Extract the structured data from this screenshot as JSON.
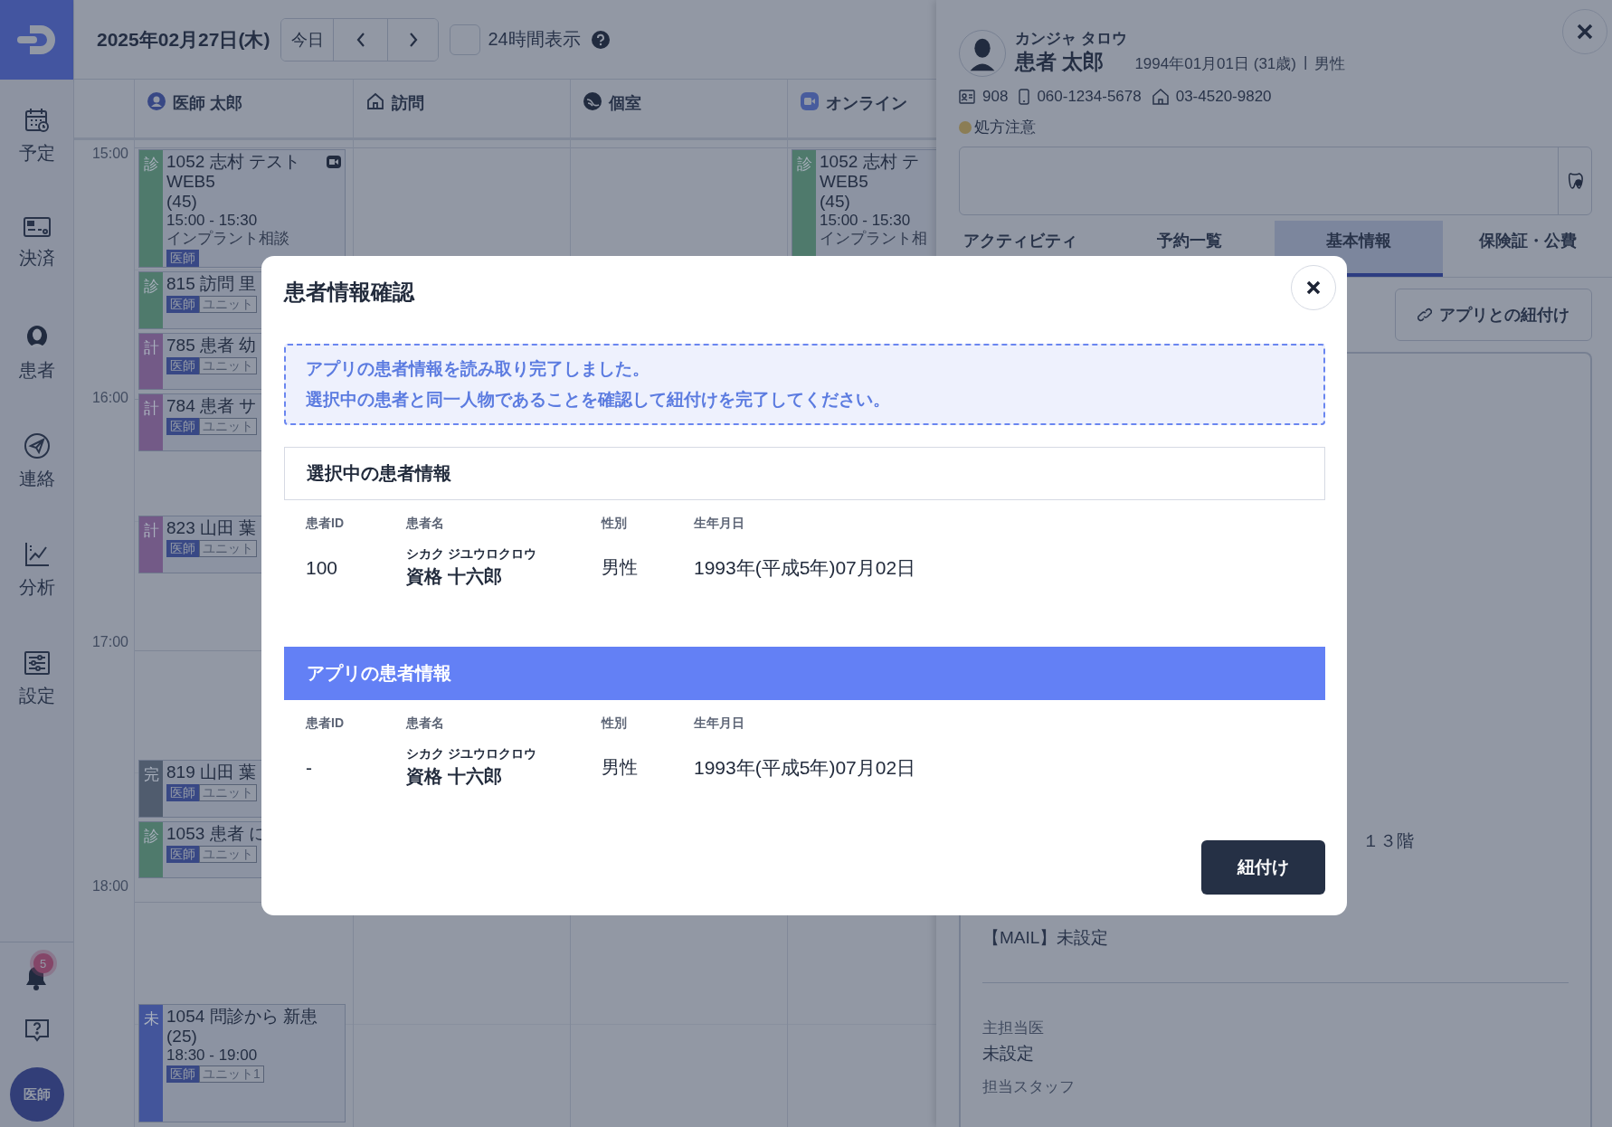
{
  "sidebar": {
    "items": [
      {
        "label": "予定"
      },
      {
        "label": "決済"
      },
      {
        "label": "患者"
      },
      {
        "label": "連絡"
      },
      {
        "label": "分析"
      },
      {
        "label": "設定"
      }
    ],
    "notification_count": "5",
    "user_badge": "医師"
  },
  "toolbar": {
    "date": "2025年02月27日(木)",
    "today_button": "今日",
    "show_24h": {
      "label": "24時間表示",
      "checked": false
    }
  },
  "calendar": {
    "times": [
      "15:00",
      "16:00",
      "17:00",
      "18:00"
    ],
    "columns": [
      {
        "name": "医師 太郎",
        "events": [
          {
            "status": "診",
            "color": "#4f7a6c",
            "title": "1052 志村 テスト",
            "lines": [
              "WEB5",
              "(45)"
            ],
            "time": "15:00 - 15:30",
            "note": "インプラント相談",
            "tags": [
              "医師"
            ],
            "online": true
          },
          {
            "status": "診",
            "color": "#4f7a6c",
            "title": "815 訪問 里",
            "tags": [
              "医師",
              "ユニット"
            ]
          },
          {
            "status": "計",
            "color": "#735a87",
            "title": "785 患者 幼",
            "tags": [
              "医師",
              "ユニット"
            ]
          },
          {
            "status": "計",
            "color": "#735a87",
            "title": "784 患者 サ",
            "tags": [
              "医師",
              "ユニット"
            ]
          },
          {
            "status": "計",
            "color": "#735a87",
            "title": "823 山田 葉",
            "tags": [
              "医師",
              "ユニット"
            ]
          },
          {
            "status": "完",
            "color": "#505c6e",
            "title": "819 山田 葉",
            "tags": [
              "医師",
              "ユニット"
            ]
          },
          {
            "status": "診",
            "color": "#4f7a6c",
            "title": "1053 患者 に",
            "tags": [
              "医師",
              "ユニット"
            ]
          },
          {
            "status": "未",
            "color": "#43559b",
            "title": "1054 問診から 新患",
            "lines": [
              "(25)"
            ],
            "time": "18:30 - 19:00",
            "tags": [
              "医師",
              "ユニット1"
            ],
            "online": false
          }
        ]
      },
      {
        "name": "訪問"
      },
      {
        "name": "個室"
      },
      {
        "name": "オンライン",
        "events": [
          {
            "status": "診",
            "color": "#4f7a6c",
            "title": "1052 志村 テ",
            "lines": [
              "WEB5",
              "(45)"
            ],
            "time": "15:00 - 15:30",
            "note": "インプラント相",
            "online": false
          }
        ]
      }
    ]
  },
  "patient_panel": {
    "name_kana": "カンジャ タロウ",
    "name": "患者 太郎",
    "birth": "1994年01月01日 (31歳)",
    "separator": "|",
    "sex": "男性",
    "patient_no": "908",
    "mobile": "060-1234-5678",
    "home": "03-4520-9820",
    "alert": {
      "label": "処方注意",
      "color": "#8b7d55"
    },
    "tabs": [
      {
        "label": "アクティビティ",
        "selected": false
      },
      {
        "label": "予約一覧",
        "selected": false
      },
      {
        "label": "基本情報",
        "selected": true
      },
      {
        "label": "保険証・公費",
        "selected": false
      }
    ],
    "link_button": "アプリとの紐付け",
    "address_tail": "１３階",
    "mail": "【MAIL】未設定",
    "fields": [
      {
        "label": "主担当医",
        "value": "未設定"
      },
      {
        "label": "担当スタッフ"
      }
    ]
  },
  "modal": {
    "title": "患者情報確認",
    "message": [
      "アプリの患者情報を読み取り完了しました。",
      "選択中の患者と同一人物であることを確認して紐付けを完了してください。"
    ],
    "sections": [
      {
        "title": "選択中の患者情報",
        "highlighted": false,
        "columns": [
          "患者ID",
          "患者名",
          "性別",
          "生年月日"
        ],
        "patient": {
          "id": "100",
          "kana": "シカク ジユウロクロウ",
          "name": "資格 十六郎",
          "sex": "男性",
          "birth": "1993年(平成5年)07月02日"
        }
      },
      {
        "title": "アプリの患者情報",
        "highlighted": true,
        "columns": [
          "患者ID",
          "患者名",
          "性別",
          "生年月日"
        ],
        "patient": {
          "id": "-",
          "kana": "シカク ジユウロクロウ",
          "name": "資格 十六郎",
          "sex": "男性",
          "birth": "1993年(平成5年)07月02日"
        }
      }
    ],
    "confirm_button": "紐付け"
  }
}
